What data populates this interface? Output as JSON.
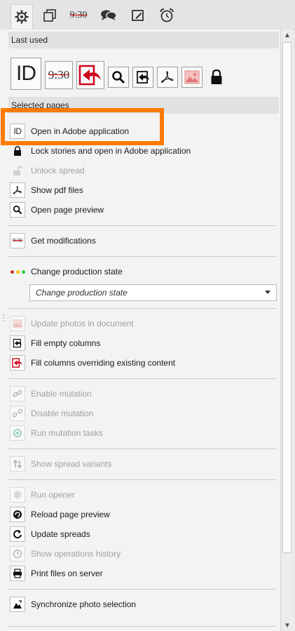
{
  "toolbar": {
    "tabs": [
      {
        "name": "gear-icon"
      },
      {
        "name": "layers-icon"
      },
      {
        "name": "time-icon",
        "text": "9:30"
      },
      {
        "name": "chat-icon"
      },
      {
        "name": "edit-icon"
      },
      {
        "name": "alarm-clock-icon"
      }
    ]
  },
  "last_used": {
    "title": "Last used",
    "icons": [
      {
        "name": "indesign-icon",
        "text": "ID"
      },
      {
        "name": "modifications-icon",
        "text": "9:30"
      },
      {
        "name": "fill-columns-override-icon"
      },
      {
        "name": "search-icon"
      },
      {
        "name": "fill-empty-icon"
      },
      {
        "name": "pdf-icon"
      },
      {
        "name": "photo-icon"
      },
      {
        "name": "lock-icon"
      }
    ]
  },
  "selected_pages": {
    "title": "Selected pages",
    "items": {
      "open_adobe": "Open in Adobe application",
      "lock_open": "Lock stories and open in Adobe application",
      "unlock_spread": "Unlock spread",
      "show_pdf": "Show pdf files",
      "open_preview": "Open page preview",
      "get_modifications": "Get modifications",
      "change_state": "Change production state",
      "update_photos": "Update photos in document",
      "fill_empty": "Fill empty columns",
      "fill_override": "Fill columns overriding existing content",
      "enable_mutation": "Enable mutation",
      "disable_mutation": "Disable mutation",
      "run_mutation": "Run mutation tasks",
      "show_variants": "Show spread variants",
      "run_opener": "Run opener",
      "reload_preview": "Reload page preview",
      "update_spreads": "Update spreads",
      "show_history": "Show operations history",
      "print_files": "Print files on server",
      "sync_photo": "Synchronize photo selection"
    },
    "state_select": {
      "value": "Change production state"
    },
    "icon_text": {
      "id": "ID",
      "time": "9:30"
    }
  },
  "colors": {
    "highlight": "#ff7a00",
    "state_dots": [
      "#c0392b",
      "#f1c40f",
      "#2ecc40"
    ],
    "accent_red": "#d0021b"
  }
}
